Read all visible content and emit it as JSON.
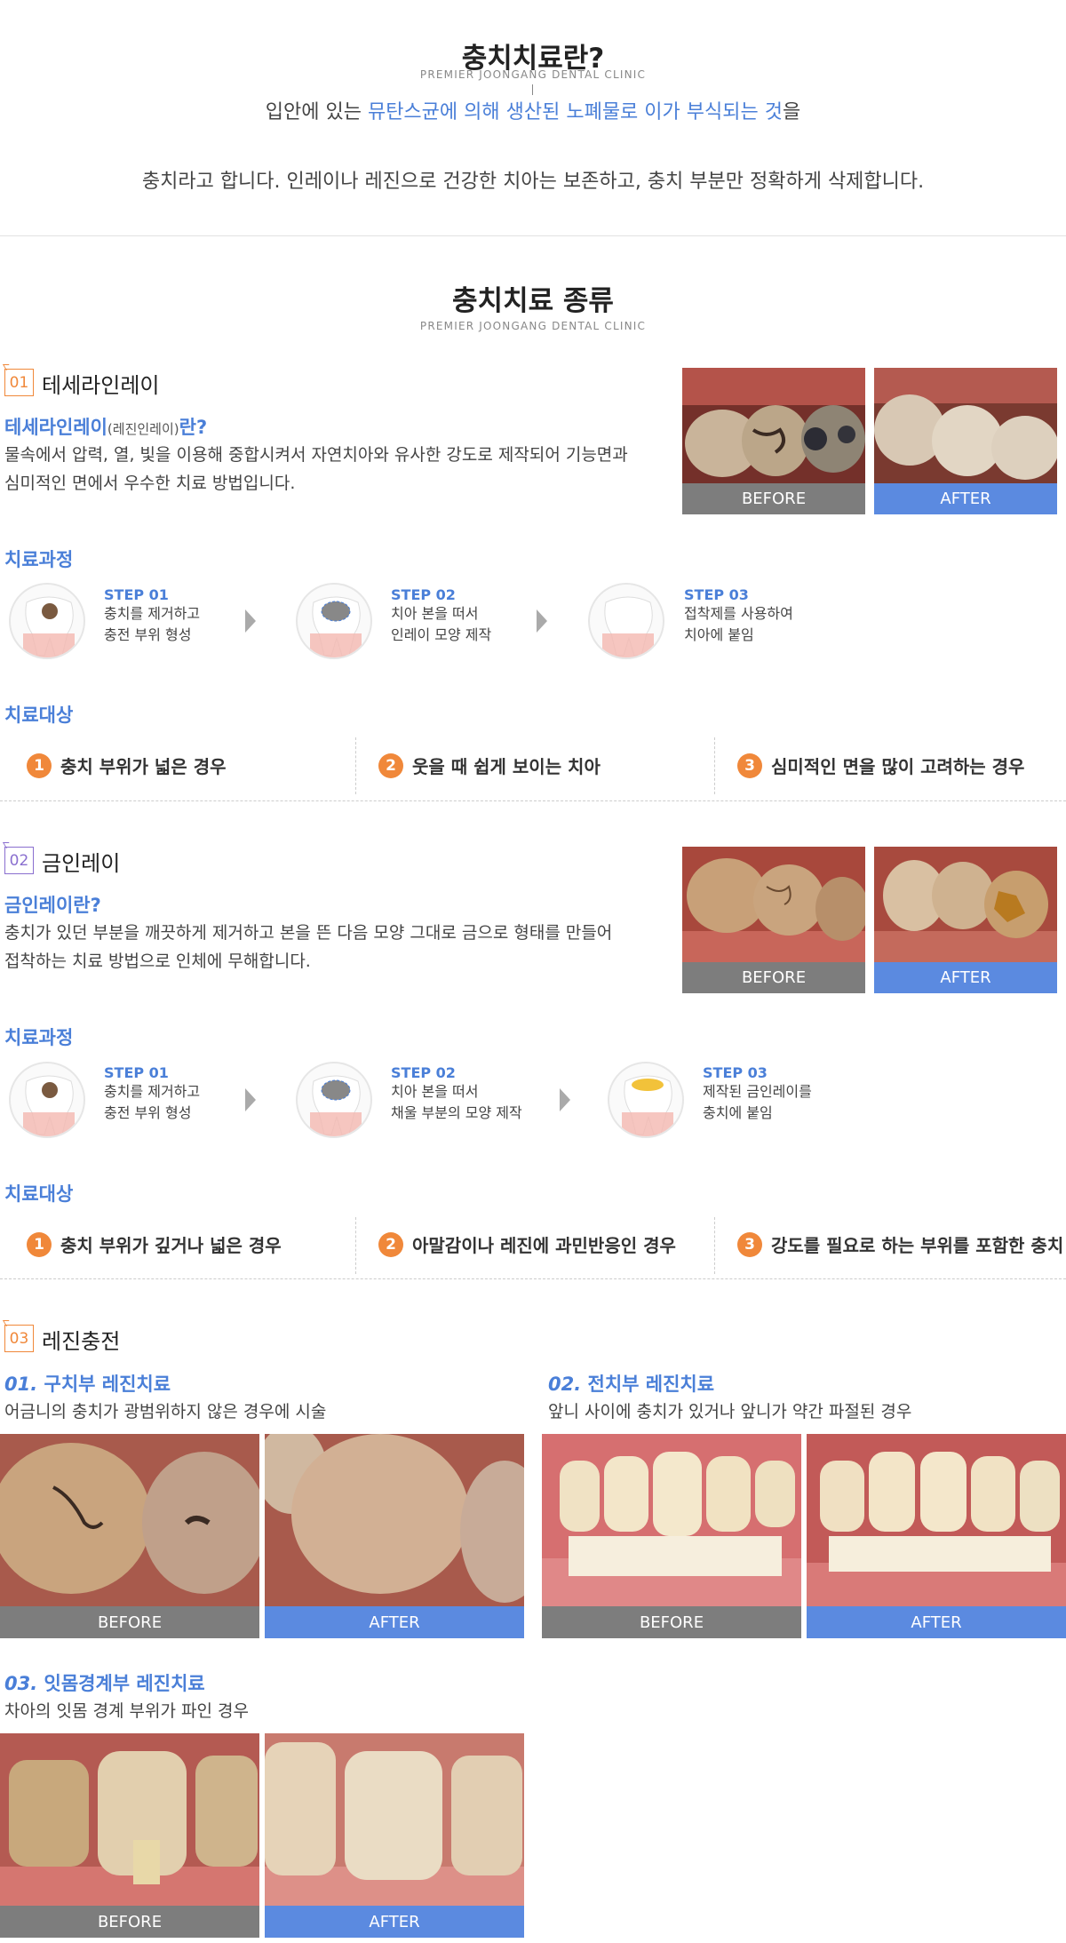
{
  "header": {
    "title": "충치치료란?",
    "subtitle": "PREMIER JOONGANG DENTAL CLINIC",
    "line1_a": "입안에 있는 ",
    "line1_hl": "뮤탄스균에 의해 생산된 노폐물로 이가 부식되는 것",
    "line1_b": "을",
    "line2": "충치라고 합니다. 인레이나 레진으로 건강한 치아는 보존하고, 충치 부분만 정확하게 삭제합니다."
  },
  "types": {
    "title": "충치치료 종류",
    "subtitle": "PREMIER JOONGANG DENTAL CLINIC"
  },
  "labels": {
    "before": "BEFORE",
    "after": "AFTER",
    "process": "치료과정",
    "target": "치료대상"
  },
  "sec1": {
    "num": "01",
    "title": "테세라인레이",
    "q_main": "테세라인레이",
    "q_small": "(레진인레이)",
    "q_end": "란?",
    "desc1": "물속에서 압력, 열, 빛을 이용해 중합시켜서 자연치아와 유사한 강도로 제작되어 기능면과",
    "desc2": "심미적인 면에서 우수한 치료 방법입니다.",
    "steps": [
      {
        "title": "STEP 01",
        "l1": "충치를 제거하고",
        "l2": "충전 부위 형성"
      },
      {
        "title": "STEP 02",
        "l1": "치아 본을 떠서",
        "l2": "인레이 모양 제작"
      },
      {
        "title": "STEP 03",
        "l1": "접착제를 사용하여",
        "l2": "치아에 붙임"
      }
    ],
    "targets": [
      {
        "n": "1",
        "t": "충치 부위가 넓은 경우"
      },
      {
        "n": "2",
        "t": "웃을 때 쉽게 보이는 치아"
      },
      {
        "n": "3",
        "t": "심미적인 면을 많이 고려하는 경우"
      }
    ]
  },
  "sec2": {
    "num": "02",
    "title": "금인레이",
    "q": "금인레이란?",
    "desc1": "충치가 있던 부분을 깨끗하게 제거하고 본을 뜬 다음 모양 그대로 금으로 형태를 만들어",
    "desc2": "접착하는 치료 방법으로 인체에 무해합니다.",
    "steps": [
      {
        "title": "STEP 01",
        "l1": "충치를 제거하고",
        "l2": "충전 부위 형성"
      },
      {
        "title": "STEP 02",
        "l1": "치아 본을 떠서",
        "l2": "채울 부분의 모양 제작"
      },
      {
        "title": "STEP 03",
        "l1": "제작된 금인레이를",
        "l2": "충치에 붙임"
      }
    ],
    "targets": [
      {
        "n": "1",
        "t": "충치 부위가 깊거나 넓은 경우"
      },
      {
        "n": "2",
        "t": "아말감이나 레진에 과민반응인 경우"
      },
      {
        "n": "3",
        "t": "강도를 필요로 하는 부위를 포함한 충치"
      }
    ]
  },
  "sec3": {
    "num": "03",
    "title": "레진충전",
    "a_num": "01.",
    "a_title": " 구치부 레진치료",
    "a_desc": "어금니의 충치가 광범위하지 않은 경우에 시술",
    "b_num": "02.",
    "b_title": " 전치부 레진치료",
    "b_desc": "앞니 사이에 충치가 있거나 앞니가 약간 파절된 경우",
    "c_num": "03.",
    "c_title": " 잇몸경계부 레진치료",
    "c_desc": "차아의 잇몸 경계 부위가 파인 경우"
  },
  "colors": {
    "accent": "#4a7fd8",
    "orange": "#f0883a",
    "before": "#7d7d7d",
    "after": "#5b8ae0"
  }
}
